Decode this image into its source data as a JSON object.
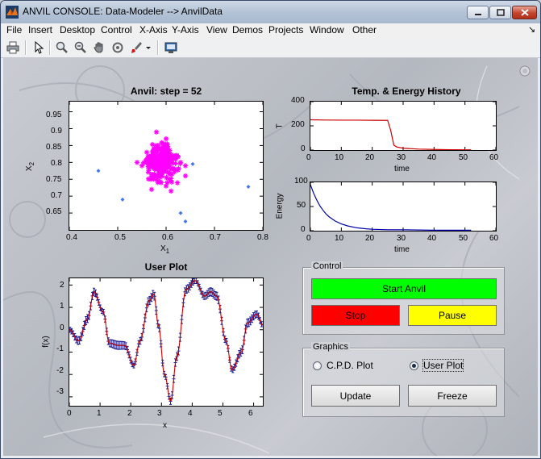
{
  "window": {
    "title": "ANVIL CONSOLE: Data-Modeler --> AnvilData",
    "controls": [
      "minimize-icon",
      "maximize-icon",
      "close-icon"
    ]
  },
  "menubar": {
    "items": [
      "File",
      "Insert",
      "Desktop",
      "Control",
      "X-Axis",
      "Y-Axis",
      "View",
      "Demos",
      "Projects",
      "Window",
      "Other"
    ],
    "corner_arrow": "↘"
  },
  "toolbar": {
    "icons": [
      "print-icon",
      "pointer-icon",
      "zoom-in-icon",
      "zoom-out-icon",
      "pan-hand-icon",
      "rotate-icon",
      "data-brush-icon",
      "dropdown-arrow-icon",
      "plot-tools-icon"
    ]
  },
  "colors": {
    "start": "#00ff00",
    "stop": "#ff0000",
    "pause": "#ffff00",
    "scatter_cloud": "#ff00ff",
    "scatter_outliers": "#4477ee",
    "temp_line": "#cc0000",
    "energy_line": "#0000aa",
    "user_fit": "#cc0000",
    "user_points": "#1a1a8c"
  },
  "plots": {
    "anvil": {
      "title": "Anvil: step = 52",
      "xlabel": "X",
      "xlabel_sub": "1",
      "ylabel": "X",
      "ylabel_sub": "2",
      "xticks": [
        "0.4",
        "0.5",
        "0.6",
        "0.7",
        "0.8"
      ],
      "yticks": [
        "0.95",
        "0.9",
        "0.85",
        "0.8",
        "0.75",
        "0.7",
        "0.65"
      ]
    },
    "history_title": "Temp. & Energy History",
    "temp": {
      "ylabel": "T",
      "xlabel": "time",
      "xticks": [
        "0",
        "10",
        "20",
        "30",
        "40",
        "50",
        "60"
      ],
      "yticks": [
        "400",
        "200",
        "0"
      ]
    },
    "energy": {
      "ylabel": "Energy",
      "xlabel": "time",
      "xticks": [
        "0",
        "10",
        "20",
        "30",
        "40",
        "50",
        "60"
      ],
      "yticks": [
        "100",
        "50",
        "0"
      ]
    },
    "user": {
      "title": "User Plot",
      "xlabel": "x",
      "ylabel": "f(x)",
      "xticks": [
        "0",
        "1",
        "2",
        "3",
        "4",
        "5",
        "6"
      ],
      "yticks": [
        "2",
        "1",
        "0",
        "-1",
        "-2",
        "-3"
      ]
    }
  },
  "chart_data": [
    {
      "type": "scatter",
      "title": "Anvil: step = 52",
      "xlabel": "X1",
      "ylabel": "X2",
      "xlim": [
        0.4,
        0.8
      ],
      "ylim": [
        0.6,
        0.98
      ],
      "series": [
        {
          "marker": "star",
          "color": "#ff00ff",
          "cluster_center": [
            0.59,
            0.8
          ],
          "spread": [
            0.025,
            0.04
          ],
          "points": [
            [
              0.55,
              0.79
            ],
            [
              0.56,
              0.83
            ],
            [
              0.57,
              0.76
            ],
            [
              0.58,
              0.85
            ],
            [
              0.6,
              0.87
            ],
            [
              0.61,
              0.78
            ],
            [
              0.62,
              0.82
            ],
            [
              0.63,
              0.8
            ],
            [
              0.64,
              0.79
            ],
            [
              0.59,
              0.74
            ],
            [
              0.6,
              0.73
            ],
            [
              0.54,
              0.8
            ],
            [
              0.64,
              0.76
            ],
            [
              0.57,
              0.72
            ],
            [
              0.58,
              0.89
            ]
          ]
        },
        {
          "marker": "dot",
          "color": "#4477ee",
          "points": [
            [
              0.46,
              0.775
            ],
            [
              0.51,
              0.69
            ],
            [
              0.63,
              0.65
            ],
            [
              0.64,
              0.625
            ],
            [
              0.77,
              0.728
            ],
            [
              0.655,
              0.795
            ]
          ]
        }
      ]
    },
    {
      "type": "line",
      "title": "Temp. & Energy History",
      "ylabel": "T",
      "xlabel": "time",
      "xlim": [
        0,
        60
      ],
      "ylim": [
        0,
        400
      ],
      "series": [
        {
          "x": [
            0,
            5,
            10,
            15,
            20,
            25,
            26,
            27,
            28,
            30,
            35,
            40,
            45,
            50,
            52
          ],
          "values": [
            250,
            248,
            247,
            247,
            246,
            245,
            160,
            40,
            25,
            15,
            8,
            5,
            3,
            2,
            2
          ]
        }
      ]
    },
    {
      "type": "line",
      "ylabel": "Energy",
      "xlabel": "time",
      "xlim": [
        0,
        60
      ],
      "ylim": [
        0,
        100
      ],
      "series": [
        {
          "x": [
            0,
            1,
            2,
            3,
            4,
            5,
            6,
            8,
            10,
            12,
            15,
            18,
            20,
            25,
            30,
            40,
            52
          ],
          "values": [
            95,
            78,
            64,
            52,
            43,
            35,
            29,
            20,
            14,
            10,
            6,
            4,
            3,
            2,
            2,
            1,
            1
          ]
        }
      ]
    },
    {
      "type": "line",
      "title": "User Plot",
      "xlabel": "x",
      "ylabel": "f(x)",
      "xlim": [
        0,
        6.3
      ],
      "ylim": [
        -3.4,
        2.3
      ],
      "series": [
        {
          "x": [
            0,
            0.3,
            0.6,
            0.8,
            1.1,
            1.3,
            1.6,
            1.8,
            2.1,
            2.3,
            2.6,
            2.75,
            2.9,
            3.1,
            3.3,
            3.5,
            3.8,
            4.1,
            4.4,
            4.6,
            4.8,
            5.1,
            5.3,
            5.6,
            5.8,
            6.1,
            6.3
          ],
          "values": [
            0,
            -0.5,
            0.5,
            1.7,
            0.8,
            -0.6,
            -0.7,
            -0.7,
            -1.6,
            -0.5,
            1.3,
            1.6,
            0.2,
            -2.0,
            -3.2,
            -1.2,
            1.8,
            2.2,
            1.5,
            1.7,
            1.5,
            -0.5,
            -1.8,
            -1.0,
            0.3,
            0.7,
            0.2
          ]
        }
      ]
    }
  ],
  "control_panel": {
    "title": "Control",
    "start": "Start Anvil",
    "stop": "Stop",
    "pause": "Pause"
  },
  "graphics_panel": {
    "title": "Graphics",
    "option_cpd": "C.P.D. Plot",
    "option_user": "User Plot",
    "selected": "User Plot",
    "update": "Update",
    "freeze": "Freeze"
  }
}
